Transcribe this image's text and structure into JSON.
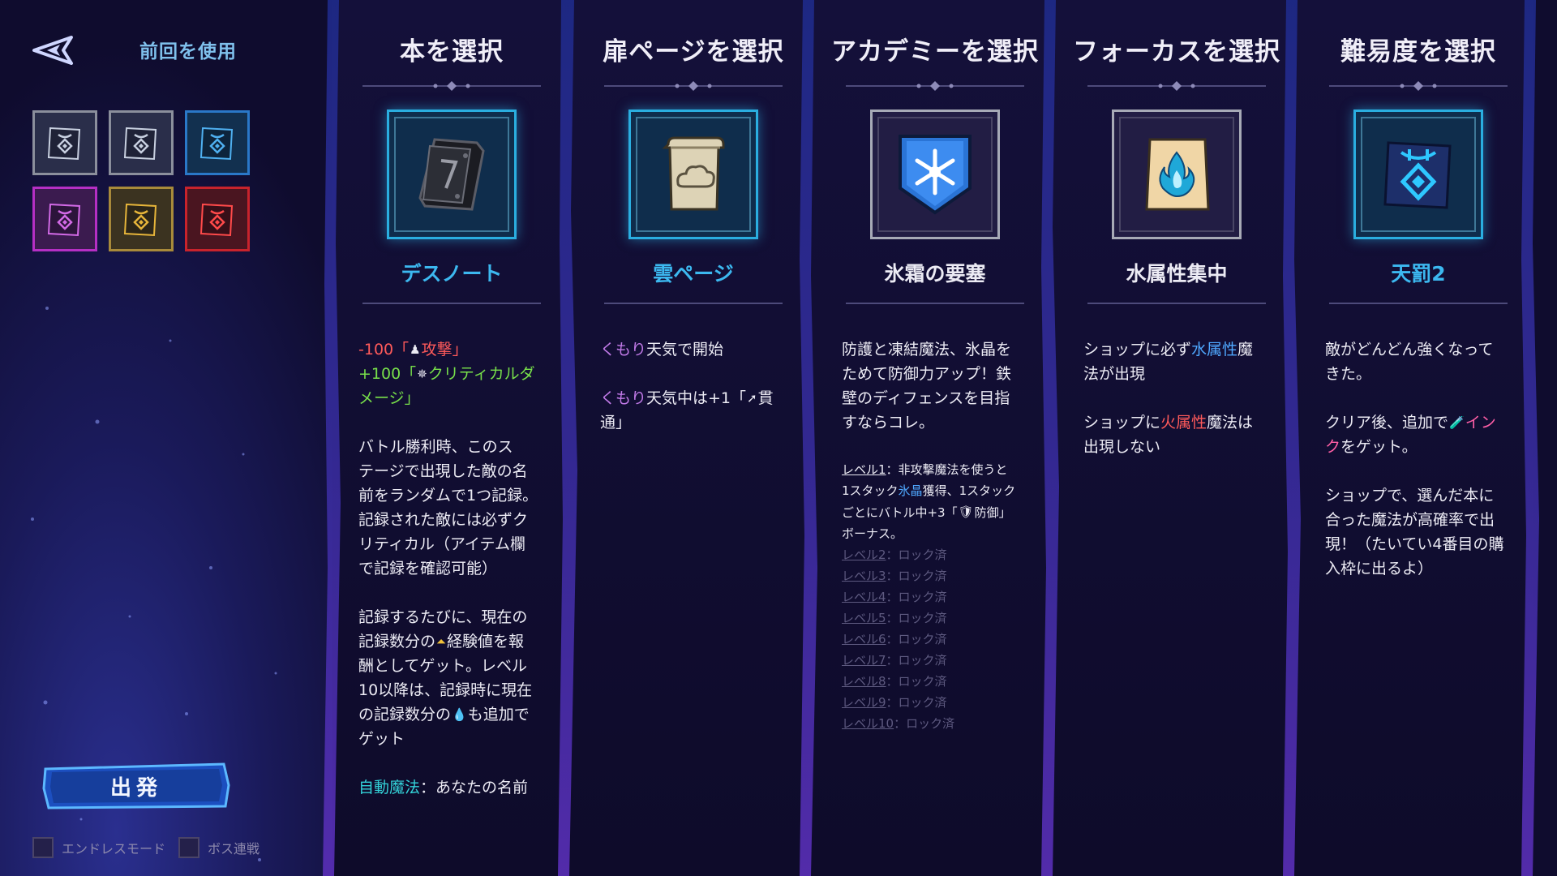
{
  "top": {
    "use_previous": "前回を使用"
  },
  "presets": [
    {
      "id": "slot-1",
      "border": "#8b8f9c",
      "bg": "#2a2e4a",
      "glyph": "#c8d0e0"
    },
    {
      "id": "slot-2",
      "border": "#8b8f9c",
      "bg": "#2a2e4a",
      "glyph": "#c8d0e0"
    },
    {
      "id": "slot-3",
      "border": "#2a78c8",
      "bg": "#12304f",
      "glyph": "#4fb0f0"
    },
    {
      "id": "slot-4",
      "border": "#b52fc4",
      "bg": "#3b1b4f",
      "glyph": "#d26ae6"
    },
    {
      "id": "slot-5",
      "border": "#a88a3a",
      "bg": "#3b3320",
      "glyph": "#e6b53a"
    },
    {
      "id": "slot-6",
      "border": "#c8232c",
      "bg": "#4a1520",
      "glyph": "#ff4a4a"
    }
  ],
  "depart": {
    "label": "出発"
  },
  "toggles": {
    "endless": "エンドレスモード",
    "boss_rush": "ボス連戦"
  },
  "columns": {
    "book": {
      "title": "本を選択",
      "name": "デスノート",
      "desc": {
        "l1_amt": "-100「",
        "l1_icon": "♟",
        "l1_kw": "攻撃",
        "l1_end": "」",
        "l2_amt": "+100「",
        "l2_icon": "✵",
        "l2_kw": "クリティカルダ",
        "l3_kw": "メージ",
        "l3_end": "」",
        "p2": [
          "バトル勝利時、このス",
          "テージで出現した敵の名",
          "前をランダムで1つ記録。",
          "記録された敵には必ずク",
          "リティカル（アイテム欄",
          "で記録を確認可能）"
        ],
        "p3_l1": "記録するたびに、現在の",
        "p3_l2a": "記録数分の",
        "p3_l2_icon": "⏶",
        "p3_l2b": "経験値を報",
        "p3_l3": "酬としてゲット。レベル",
        "p3_l4": "10以降は、記録時に現在",
        "p3_l5a": "の記録数分の",
        "p3_l5_icon": "💧",
        "p3_l5b": "も追加で",
        "p3_l6": "ゲット",
        "auto_kw": "自動魔法",
        "auto_rest": "：あなたの名前"
      }
    },
    "page": {
      "title": "扉ページを選択",
      "name": "雲ページ",
      "desc": {
        "l1_kw": "くもり",
        "l1_rest": "天気で開始",
        "l2_kw": "くもり",
        "l2_rest": "天気中は+1「",
        "l2_icon": "➚",
        "l2_end": "貫",
        "l3": "通」"
      }
    },
    "academy": {
      "title": "アカデミーを選択",
      "name": "氷霜の要塞",
      "desc": {
        "p1": [
          "防護と凍結魔法、氷晶を",
          "ためて防御力アップ！鉄",
          "壁のディフェンスを目指",
          "すならコレ。"
        ],
        "lv1_name": "レベル1",
        "lv1_a": "：非攻撃魔法を使うと",
        "lv1_b1": "1スタック",
        "lv1_b_kw": "氷晶",
        "lv1_b2": "獲得、1スタック",
        "lv1_c1": "ごとにバトル中+3「",
        "lv1_c_icon": "🛡",
        "lv1_c2": "防御」",
        "lv1_d": "ボーナス。",
        "locked_text": "：ロック済",
        "locked_levels": [
          "レベル2",
          "レベル3",
          "レベル4",
          "レベル5",
          "レベル6",
          "レベル7",
          "レベル8",
          "レベル9",
          "レベル10"
        ]
      }
    },
    "focus": {
      "title": "フォーカスを選択",
      "name": "水属性集中",
      "desc": {
        "l1a": "ショップに必ず",
        "l1_kw": "水属性",
        "l1b": "魔",
        "l2": "法が出現",
        "l3a": "ショップに",
        "l3_kw": "火属性",
        "l3b": "魔法は",
        "l4": "出現しない"
      }
    },
    "difficulty": {
      "title": "難易度を選択",
      "name": "天罰2",
      "desc": {
        "p1": [
          "敵がどんどん強くなって",
          "きた。"
        ],
        "l3a": "クリア後、追加で",
        "l3_icon": "🧪",
        "l3_kw": "イン",
        "l4_kw": "ク",
        "l4b": "をゲット。",
        "p3": [
          "ショップで、選んだ本に",
          "合った魔法が高確率で出",
          "現！（たいてい4番目の購",
          "入枠に出るよ）"
        ]
      }
    }
  },
  "colors": {
    "accent_blue": "#2aaee0",
    "name_blue": "#3cb8f0",
    "name_white": "#ecebf4",
    "negative": "#ff5a5a",
    "positive": "#78e04a"
  }
}
